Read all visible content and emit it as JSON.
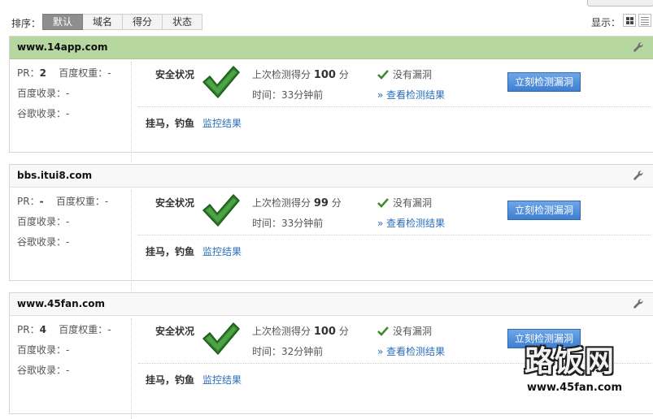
{
  "toolbar": {
    "sort_label": "排序：",
    "sort_tabs": [
      {
        "label": "默认",
        "active": true
      },
      {
        "label": "域名",
        "active": false
      },
      {
        "label": "得分",
        "active": false
      },
      {
        "label": "状态",
        "active": false
      }
    ],
    "display_label": "显示："
  },
  "sites": [
    {
      "domain": "www.14app.com",
      "highlighted": true,
      "pr_label": "PR：",
      "pr": "2",
      "baidu_weight_label": "百度权重：",
      "baidu_weight": "-",
      "baidu_index_label": "百度收录：",
      "baidu_index": "-",
      "google_index_label": "谷歌收录：",
      "google_index": "-",
      "safety_label": "安全状况",
      "score_prefix": "上次检测得分",
      "score": "100",
      "score_unit": "分",
      "time_text": "时间：33分钟前",
      "vuln_status": "没有漏洞",
      "view_result": "» 查看检测结果",
      "detect_button": "立刻检测漏洞",
      "trojan_label": "挂马，钓鱼",
      "monitor_link": "监控结果"
    },
    {
      "domain": "bbs.itui8.com",
      "highlighted": false,
      "pr_label": "PR：",
      "pr": "-",
      "baidu_weight_label": "百度权重：",
      "baidu_weight": "-",
      "baidu_index_label": "百度收录：",
      "baidu_index": "-",
      "google_index_label": "谷歌收录：",
      "google_index": "-",
      "safety_label": "安全状况",
      "score_prefix": "上次检测得分",
      "score": "99",
      "score_unit": "分",
      "time_text": "时间：33分钟前",
      "vuln_status": "没有漏洞",
      "view_result": "» 查看检测结果",
      "detect_button": "立刻检测漏洞",
      "trojan_label": "挂马，钓鱼",
      "monitor_link": "监控结果"
    },
    {
      "domain": "www.45fan.com",
      "highlighted": false,
      "pr_label": "PR：",
      "pr": "4",
      "baidu_weight_label": "百度权重：",
      "baidu_weight": "-",
      "baidu_index_label": "百度收录：",
      "baidu_index": "-",
      "google_index_label": "谷歌收录：",
      "google_index": "-",
      "safety_label": "安全状况",
      "score_prefix": "上次检测得分",
      "score": "100",
      "score_unit": "分",
      "time_text": "时间：32分钟前",
      "vuln_status": "没有漏洞",
      "view_result": "» 查看检测结果",
      "detect_button": "立刻检测漏洞",
      "trojan_label": "挂马，钓鱼",
      "monitor_link": "监控结果"
    }
  ],
  "watermark": {
    "title": "路饭网",
    "url": "www.45fan.com"
  },
  "icons": {
    "settings": "wrench-icon",
    "safe": "checkmark-icon",
    "grid_view": "grid-view-icon",
    "list_view": "list-view-icon"
  },
  "colors": {
    "highlight_header": "#b6d7a0",
    "link": "#2a6db8",
    "button": "#4a8ad8",
    "check": "#3b8a2e"
  }
}
